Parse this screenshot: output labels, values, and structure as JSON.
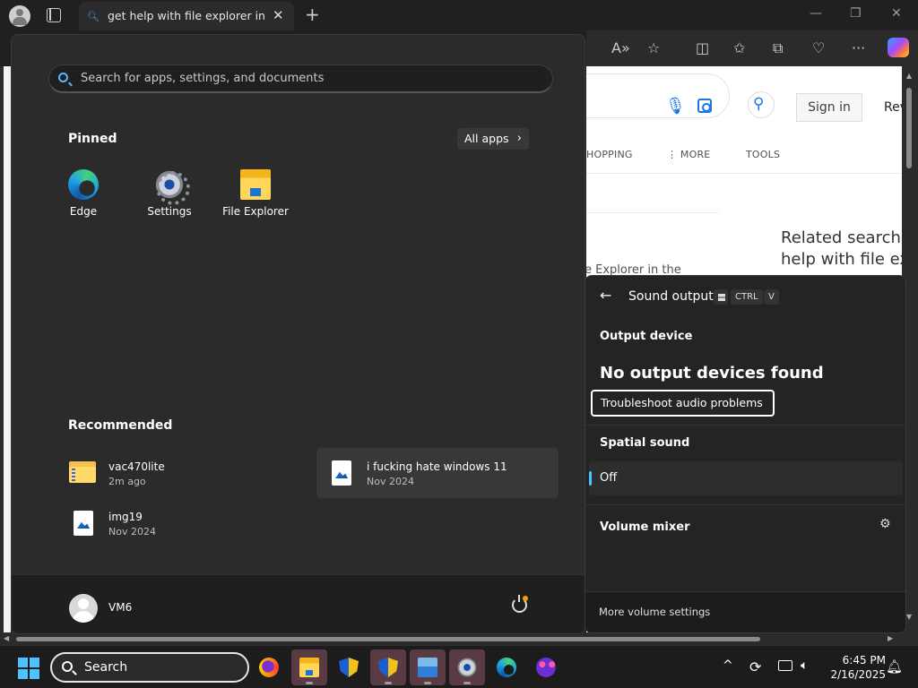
{
  "browser": {
    "tab_title": "get help with file explorer in windows",
    "tab_close": "✕",
    "new_tab": "+",
    "window_controls": {
      "minimize": "—",
      "maximize": "❐",
      "close": "✕"
    },
    "toolbar_icons": [
      "read-aloud-icon",
      "favorite-star-icon",
      "split-screen-icon",
      "favorites-icon",
      "collections-icon",
      "health-icon",
      "more-icon",
      "copilot-icon"
    ]
  },
  "webpage": {
    "sign_in": "Sign in",
    "rev_fragment": "Rev",
    "nav_tabs": [
      "HOPPING",
      "⋮ MORE",
      "TOOLS"
    ],
    "related_line1": "Related searche",
    "related_line2": "help with file ex",
    "snippet": "e Explorer in the"
  },
  "start_menu": {
    "search_placeholder": "Search for apps, settings, and documents",
    "pinned_title": "Pinned",
    "all_apps_label": "All apps",
    "all_apps_chevron": "›",
    "pinned": [
      {
        "label": "Edge",
        "icon": "edge-icon"
      },
      {
        "label": "Settings",
        "icon": "settings-gear-icon"
      },
      {
        "label": "File Explorer",
        "icon": "folder-icon"
      }
    ],
    "recommended_title": "Recommended",
    "recommended": [
      {
        "name": "vac470lite",
        "time": "2m ago",
        "icon": "zip-folder-icon"
      },
      {
        "name": "i fucking hate windows 11",
        "time": "Nov 2024",
        "icon": "image-file-icon"
      },
      {
        "name": "img19",
        "time": "Nov 2024",
        "icon": "image-file-icon"
      }
    ],
    "user_name": "VM6"
  },
  "sound_flyout": {
    "back_glyph": "←",
    "title": "Sound output",
    "shortcut_keys": [
      "CTRL",
      "V"
    ],
    "output_device_heading": "Output device",
    "no_devices": "No output devices found",
    "troubleshoot": "Troubleshoot audio problems",
    "spatial_heading": "Spatial sound",
    "spatial_value": "Off",
    "mixer_heading": "Volume mixer",
    "more_settings": "More volume settings"
  },
  "taskbar": {
    "search_label": "Search",
    "apps": [
      "firefox-icon",
      "file-explorer-icon",
      "shield-icon",
      "shield-icon",
      "photos-icon",
      "settings-icon",
      "edge-icon",
      "mask-app-icon"
    ],
    "time": "6:45 PM",
    "date": "2/16/2025",
    "tray_chevron": "^"
  },
  "colors": {
    "accent": "#4cc2ff",
    "start_bg": "#2b2b2b",
    "flyout_bg": "#242424",
    "taskbar_bg": "#1c1c1c"
  }
}
